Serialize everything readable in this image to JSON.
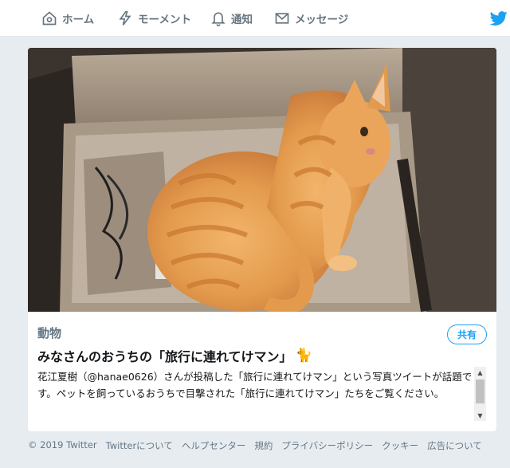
{
  "nav": {
    "home": "ホーム",
    "moments": "モーメント",
    "notifications": "通知",
    "messages": "メッセージ"
  },
  "card": {
    "category": "動物",
    "share_label": "共有",
    "title": "みなさんのおうちの「旅行に連れてけマン」",
    "title_emoji": "🐈",
    "description": "花江夏樹（@hanae0626）さんが投稿した「旅行に連れてけマン」という写真ツイートが話題です。ペットを飼っているおうちで目撃された「旅行に連れてけマン」たちをご覧ください。"
  },
  "footer": {
    "links": [
      "© 2019 Twitter",
      "Twitterについて",
      "ヘルプセンター",
      "規約",
      "プライバシーポリシー",
      "クッキー",
      "広告について"
    ]
  },
  "colors": {
    "accent": "#1da1f2",
    "muted": "#657786",
    "background": "#e6ecf0"
  },
  "icons": {
    "home": "home-icon",
    "moments": "lightning-icon",
    "notifications": "bell-icon",
    "messages": "envelope-icon",
    "brand": "twitter-bird-icon"
  }
}
